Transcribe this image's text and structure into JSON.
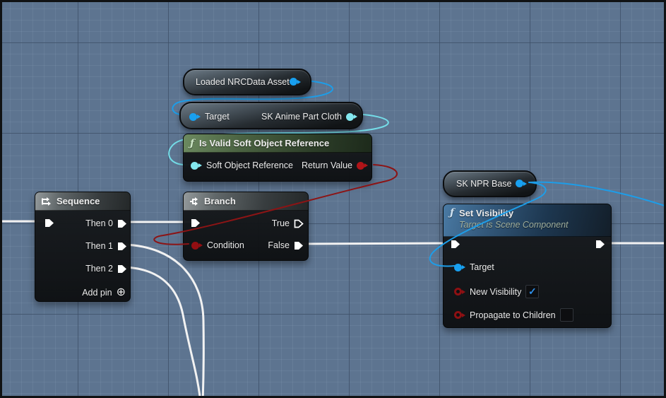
{
  "colors": {
    "background": "#5d7490",
    "grid_minor": "#6b85a1",
    "grid_major": "#4e6280",
    "exec_wire": "#f2f2f2",
    "object_wire": "#1d9de8",
    "soft_object_wire": "#74dde8",
    "bool_wire": "#8c1415",
    "object_pin": "#18a0f0",
    "soft_object_pin": "#84e8ef",
    "bool_pin": "#930e12",
    "return_pin": "#b01418",
    "checkbox_check": "#2f8fe8"
  },
  "nodes": {
    "loaded_asset": {
      "label": "Loaded NRCData Asset"
    },
    "anime_part_cloth": {
      "input_label": "Target",
      "label": "SK Anime Part Cloth"
    },
    "is_valid": {
      "icon": "ƒ",
      "title": "Is Valid Soft Object Reference",
      "input_label": "Soft Object Reference",
      "output_label": "Return Value"
    },
    "sequence": {
      "title": "Sequence",
      "then_0": "Then 0",
      "then_1": "Then 1",
      "then_2": "Then 2",
      "add_pin": "Add pin",
      "add_pin_icon": "⊕"
    },
    "branch": {
      "title": "Branch",
      "condition_label": "Condition",
      "true_label": "True",
      "false_label": "False"
    },
    "npr_base": {
      "label": "SK NPR Base"
    },
    "set_visibility": {
      "icon": "ƒ",
      "title": "Set Visibility",
      "subtitle": "Target is Scene Component",
      "target_label": "Target",
      "new_visibility_label": "New Visibility",
      "new_visibility_checked": true,
      "propagate_label": "Propagate to Children",
      "propagate_checked": false
    }
  }
}
